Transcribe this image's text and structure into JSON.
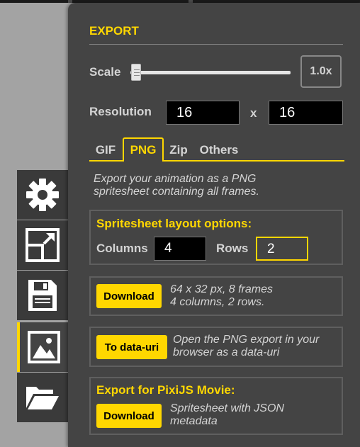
{
  "export": {
    "title": "EXPORT",
    "scale": {
      "label": "Scale",
      "value": "1.0x",
      "slider_level": 0
    },
    "resolution": {
      "label": "Resolution",
      "width": "16",
      "separator": "x",
      "height": "16"
    },
    "tabs": [
      {
        "label": "GIF",
        "active": false
      },
      {
        "label": "PNG",
        "active": true
      },
      {
        "label": "Zip",
        "active": false
      },
      {
        "label": "Others",
        "active": false
      }
    ],
    "png": {
      "description_line1": "Export your animation as a PNG",
      "description_line2": "spritesheet containing all frames.",
      "layout": {
        "title": "Spritesheet layout options:",
        "columns_label": "Columns",
        "columns_value": "4",
        "rows_label": "Rows",
        "rows_value": "2"
      },
      "download": {
        "button": "Download",
        "info_line1": "64 x 32 px, 8 frames",
        "info_line2": "4 columns, 2 rows."
      },
      "datauri": {
        "button": "To data-uri",
        "info_line1": "Open the PNG export in your",
        "info_line2": "browser as a data-uri"
      },
      "pixijs": {
        "title": "Export for PixiJS Movie:",
        "button": "Download",
        "info_line1": "Spritesheet with JSON",
        "info_line2": "metadata"
      }
    }
  },
  "toolbar": {
    "items": [
      {
        "icon": "gear-icon"
      },
      {
        "icon": "resize-icon"
      },
      {
        "icon": "save-icon"
      },
      {
        "icon": "image-icon",
        "active": true
      },
      {
        "icon": "folder-open-icon"
      }
    ]
  },
  "colors": {
    "accent": "#ffd700",
    "panel": "#444444",
    "background": "#a3a3a3"
  }
}
